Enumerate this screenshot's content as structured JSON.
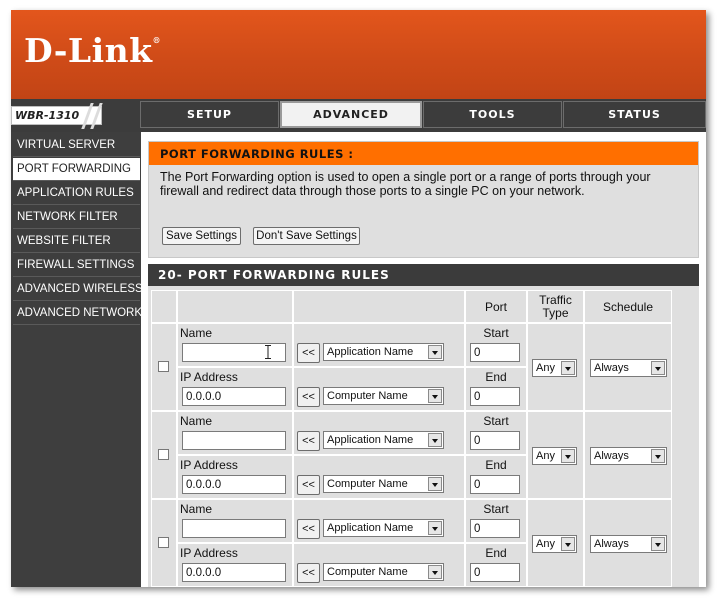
{
  "brand": {
    "logo": "D-Link",
    "registered": "®",
    "model": "WBR-1310"
  },
  "tabs": [
    "SETUP",
    "ADVANCED",
    "TOOLS",
    "STATUS"
  ],
  "active_tab": "ADVANCED",
  "sidebar": {
    "items": [
      "VIRTUAL SERVER",
      "PORT FORWARDING",
      "APPLICATION RULES",
      "NETWORK FILTER",
      "WEBSITE FILTER",
      "FIREWALL SETTINGS",
      "ADVANCED WIRELESS",
      "ADVANCED NETWORK"
    ],
    "active": "PORT FORWARDING"
  },
  "intro": {
    "title": "PORT FORWARDING RULES :",
    "text": "The Port Forwarding option is used to open a single port or a range of ports through your firewall and redirect data through those ports to a single PC on your network.",
    "save_label": "Save Settings",
    "dont_save_label": "Don't Save Settings"
  },
  "rules": {
    "title": "20- PORT FORWARDING RULES",
    "headers": {
      "port": "Port",
      "traffic": "Traffic Type",
      "schedule": "Schedule"
    },
    "labels": {
      "name": "Name",
      "ip": "IP Address",
      "start": "Start",
      "end": "End",
      "copy": "<<"
    },
    "rows": [
      {
        "name": "",
        "ip": "0.0.0.0",
        "app": "Application Name",
        "computer": "Computer Name",
        "start": "0",
        "end": "0",
        "traffic": "Any",
        "schedule": "Always"
      },
      {
        "name": "",
        "ip": "0.0.0.0",
        "app": "Application Name",
        "computer": "Computer Name",
        "start": "0",
        "end": "0",
        "traffic": "Any",
        "schedule": "Always"
      },
      {
        "name": "",
        "ip": "0.0.0.0",
        "app": "Application Name",
        "computer": "Computer Name",
        "start": "0",
        "end": "0",
        "traffic": "Any",
        "schedule": "Always"
      }
    ]
  }
}
